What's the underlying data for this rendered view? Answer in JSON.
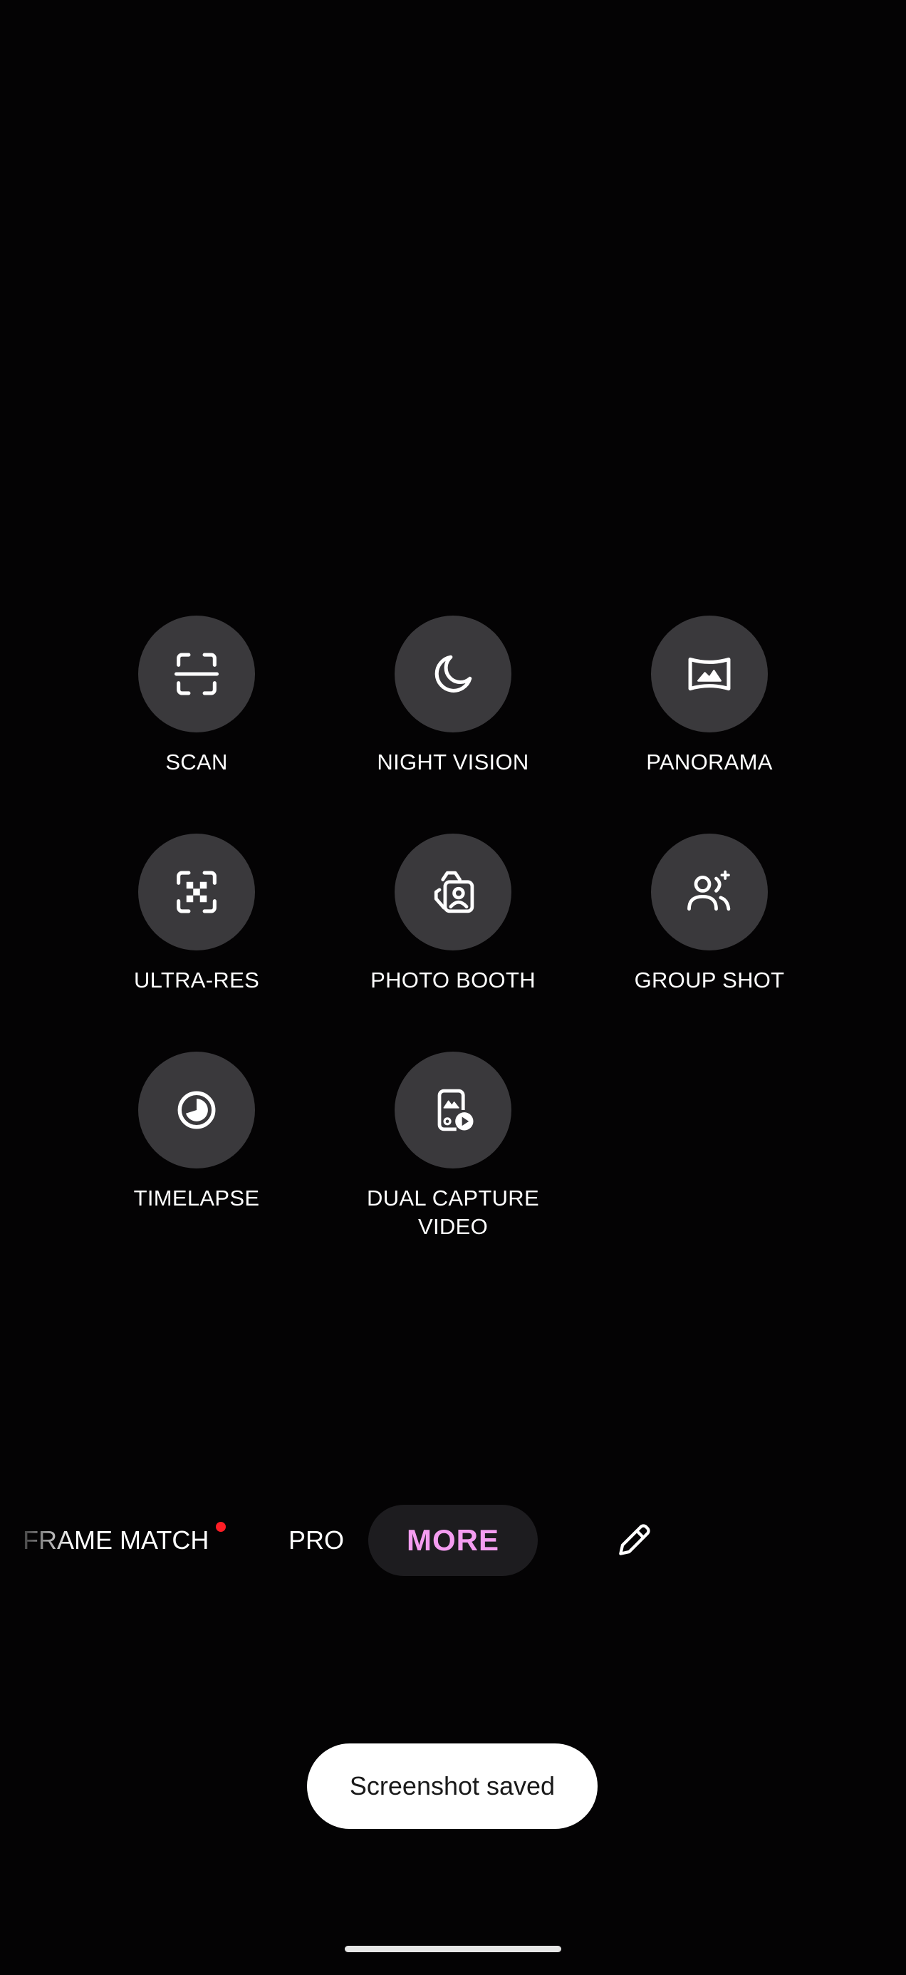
{
  "modes": [
    {
      "label": "SCAN",
      "icon": "scan-icon"
    },
    {
      "label": "NIGHT VISION",
      "icon": "moon-icon"
    },
    {
      "label": "PANORAMA",
      "icon": "panorama-icon"
    },
    {
      "label": "ULTRA-RES",
      "icon": "ultra-res-icon"
    },
    {
      "label": "PHOTO BOOTH",
      "icon": "photo-booth-icon"
    },
    {
      "label": "GROUP SHOT",
      "icon": "group-shot-icon"
    },
    {
      "label": "TIMELAPSE",
      "icon": "timelapse-icon"
    },
    {
      "label": "DUAL CAPTURE\nVIDEO",
      "icon": "dual-capture-video-icon"
    }
  ],
  "tabs": {
    "frame_match": "FRAME MATCH",
    "pro": "PRO",
    "more": "MORE",
    "edit_icon": "pencil-icon"
  },
  "colors": {
    "background": "#040304",
    "circle": "#3a393c",
    "more_text": "#f59df1",
    "new_dot": "#ff1d25"
  },
  "toast": "Screenshot saved"
}
